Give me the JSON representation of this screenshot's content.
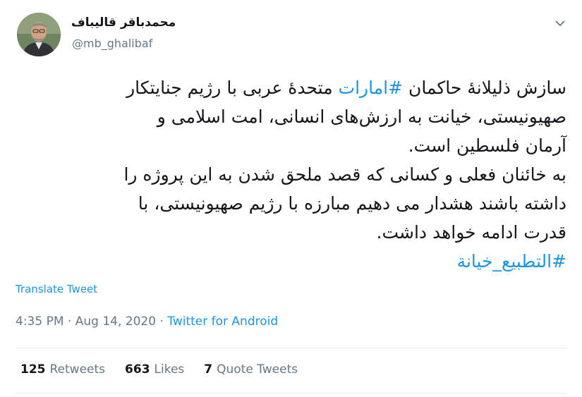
{
  "author": {
    "display_name": "محمدباقر قالیباف",
    "handle": "@mb_ghalibaf"
  },
  "icons": {
    "menu": "chevron-down-icon",
    "avatar": "profile-photo"
  },
  "tweet": {
    "lines": [
      {
        "before": "سازش ذلیلانهٔ حاکمان ",
        "link": "#امارات",
        "after": " متحدهٔ عربی با رژیم جنایتکار"
      },
      {
        "text": "صهیونیستی، خیانت به ارزش‌های انسانی، امت اسلامی و"
      },
      {
        "text": "آرمان فلسطین است."
      },
      {
        "text": "به خائنان فعلی و کسانی که قصد ملحق شدن به این پروژه را"
      },
      {
        "text": "داشته باشند هشدار می دهیم مبارزه با رژیم صهیونیستی، با"
      },
      {
        "text": "قدرت ادامه خواهد داشت."
      },
      {
        "link": "#التطبیع_خیانة"
      }
    ],
    "translate_label": "Translate Tweet",
    "time": "4:35 PM",
    "separator": "·",
    "date": "Aug 14, 2020",
    "source": "Twitter for Android"
  },
  "stats": {
    "retweets_count": "125",
    "retweets_label": "Retweets",
    "likes_count": "663",
    "likes_label": "Likes",
    "quotes_count": "7",
    "quotes_label": "Quote Tweets"
  },
  "colors": {
    "link": "#1b95e0",
    "secondary_text": "#657786",
    "primary_text": "#14171a",
    "divider": "#e6ecf0"
  }
}
